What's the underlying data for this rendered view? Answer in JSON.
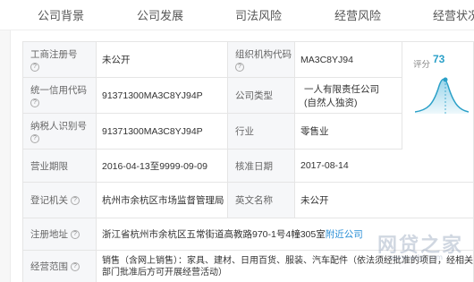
{
  "tabs": [
    "公司背景",
    "公司发展",
    "司法风险",
    "经营风险",
    "经营状况"
  ],
  "score": {
    "label": "评分",
    "value": "73",
    "color": "#2aa0c8"
  },
  "rows": [
    {
      "label1": "工商注册号",
      "value1": "未公开",
      "label2": "组织机构代码",
      "value2": "MA3C8YJ94"
    },
    {
      "label1": "统一信用代码",
      "value1": "91371300MA3C8YJ94P",
      "label2": "公司类型",
      "value2_line1": "一人有限责任公司",
      "value2_line2": "(自然人独资)"
    },
    {
      "label1": "纳税人识别号",
      "value1": "91371300MA3C8YJ94P",
      "label2": "行业",
      "value2": "零售业"
    },
    {
      "label1": "营业期限",
      "value1": "2016-04-13至9999-09-09",
      "label2": "核准日期",
      "value2": "2017-08-14"
    },
    {
      "label1": "登记机关",
      "value1": "杭州市余杭区市场监督管理局",
      "label2": "英文名称",
      "value2": "未公开"
    }
  ],
  "address": {
    "label": "注册地址",
    "value": "浙江省杭州市余杭区五常街道高教路970-1号4幢305室",
    "link": "附近公司"
  },
  "scope": {
    "label": "经营范围",
    "line1": "销售（含网上销售）：家具、建材、日用百货、服装、汽车配件（依法须经批准的项目，经相关",
    "line2": "部门批准后方可开展经营活动）"
  },
  "watermark": {
    "text": "网贷之家",
    "sub": "www.wdzj.com"
  }
}
